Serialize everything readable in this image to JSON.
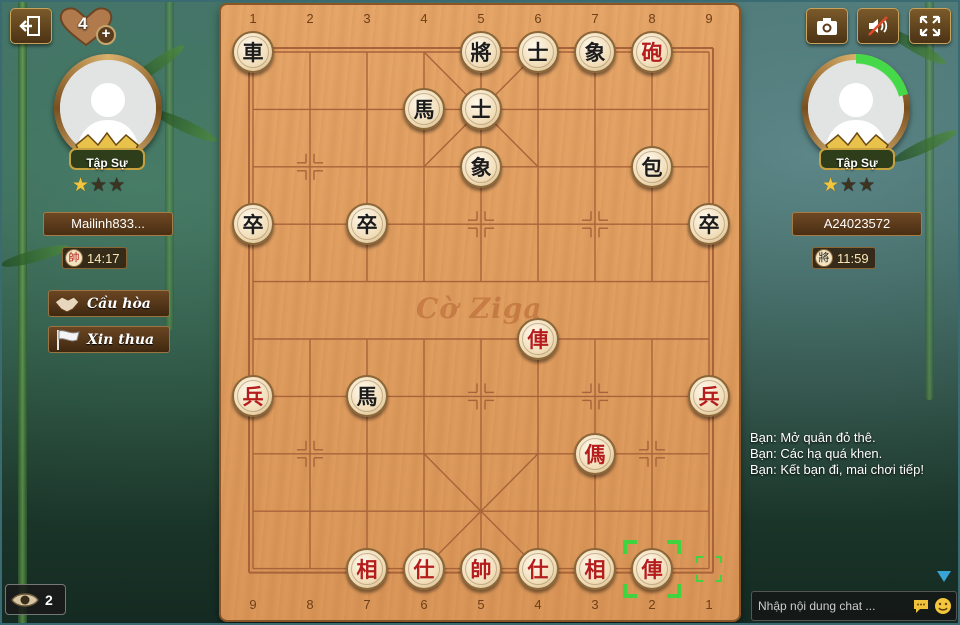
{
  "top_left": {
    "hearts": "4",
    "hearts_plus": "+"
  },
  "left_player": {
    "rank": "Tập Sự",
    "stars_on": 1,
    "stars_total": 3,
    "name": "Mailinh833...",
    "clock_piece": "帥",
    "clock_time": "14:17",
    "draw_label": "Cầu hòa",
    "resign_label": "Xin thua"
  },
  "right_player": {
    "rank": "Tập Sự",
    "stars_on": 1,
    "stars_total": 3,
    "name": "A24023572",
    "clock_piece": "將",
    "clock_time": "11:59"
  },
  "board": {
    "watermark": "Cờ Ziga",
    "top_numbers": [
      "1",
      "2",
      "3",
      "4",
      "5",
      "6",
      "7",
      "8",
      "9"
    ],
    "bottom_numbers": [
      "9",
      "8",
      "7",
      "6",
      "5",
      "4",
      "3",
      "2",
      "1"
    ],
    "pieces": [
      {
        "char": "車",
        "side": "black",
        "file": 0,
        "rank": 0
      },
      {
        "char": "將",
        "side": "black",
        "file": 4,
        "rank": 0
      },
      {
        "char": "士",
        "side": "black",
        "file": 5,
        "rank": 0
      },
      {
        "char": "象",
        "side": "black",
        "file": 6,
        "rank": 0
      },
      {
        "char": "砲",
        "side": "red",
        "file": 7,
        "rank": 0
      },
      {
        "char": "馬",
        "side": "black",
        "file": 3,
        "rank": 1
      },
      {
        "char": "士",
        "side": "black",
        "file": 4,
        "rank": 1
      },
      {
        "char": "象",
        "side": "black",
        "file": 4,
        "rank": 2
      },
      {
        "char": "包",
        "side": "black",
        "file": 7,
        "rank": 2
      },
      {
        "char": "卒",
        "side": "black",
        "file": 0,
        "rank": 3
      },
      {
        "char": "卒",
        "side": "black",
        "file": 2,
        "rank": 3
      },
      {
        "char": "卒",
        "side": "black",
        "file": 8,
        "rank": 3
      },
      {
        "char": "俥",
        "side": "red",
        "file": 5,
        "rank": 5
      },
      {
        "char": "兵",
        "side": "red",
        "file": 0,
        "rank": 6
      },
      {
        "char": "馬",
        "side": "black",
        "file": 2,
        "rank": 6
      },
      {
        "char": "兵",
        "side": "red",
        "file": 8,
        "rank": 6
      },
      {
        "char": "傌",
        "side": "red",
        "file": 6,
        "rank": 7
      },
      {
        "char": "相",
        "side": "red",
        "file": 2,
        "rank": 9
      },
      {
        "char": "仕",
        "side": "red",
        "file": 3,
        "rank": 9
      },
      {
        "char": "帥",
        "side": "red",
        "file": 4,
        "rank": 9
      },
      {
        "char": "仕",
        "side": "red",
        "file": 5,
        "rank": 9
      },
      {
        "char": "相",
        "side": "red",
        "file": 6,
        "rank": 9
      },
      {
        "char": "俥",
        "side": "red",
        "file": 7,
        "rank": 9,
        "selected": true
      }
    ],
    "move_hint": {
      "file": 8,
      "rank": 9
    }
  },
  "chat": {
    "messages": [
      "Bạn: Mở quân đỏ thê.",
      "Bạn: Các hạ quá khen.",
      "Bạn: Kết bạn đi, mai chơi tiếp!"
    ],
    "input_placeholder": "Nhập nội dung chat ..."
  },
  "viewers": {
    "count": "2"
  },
  "colors": {
    "red_piece": "#b51c1c",
    "black_piece": "#1c1c1c",
    "board": "#e2a062",
    "select": "#3fd43f"
  }
}
